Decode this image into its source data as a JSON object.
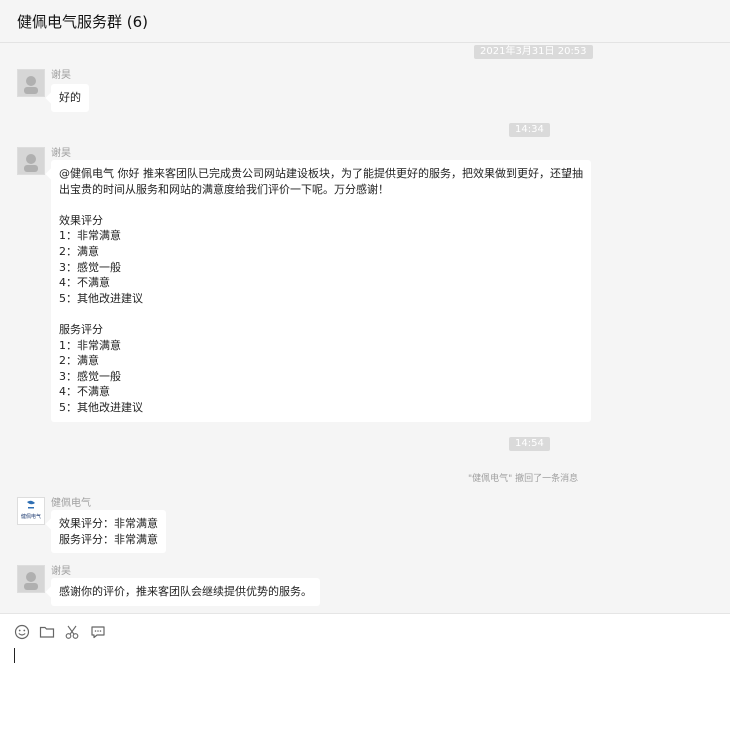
{
  "header": {
    "title": "健佩电气服务群 (6)"
  },
  "messages": {
    "ts1": "2021年3月31日 20:53",
    "m1": {
      "sender": "谢昊",
      "text": "好的"
    },
    "ts2": "14:34",
    "m2": {
      "sender": "谢昊",
      "text": "@健佩电气 你好 推来客团队已完成贵公司网站建设板块，为了能提供更好的服务，把效果做到更好，还望抽出宝贵的时间从服务和网站的满意度给我们评价一下呢。万分感谢！\n\n效果评分\n1：非常满意\n2：满意\n3：感觉一般\n4：不满意\n5：其他改进建议\n\n服务评分\n1：非常满意\n2：满意\n3：感觉一般\n4：不满意\n5：其他改进建议"
    },
    "ts3": "14:54",
    "recall": "\"健佩电气\" 撤回了一条消息",
    "m3": {
      "sender": "健佩电气",
      "logo_text": "健佩电气",
      "text": "效果评分：非常满意\n服务评分：非常满意"
    },
    "m4": {
      "sender": "谢昊",
      "text": "感谢你的评价，推来客团队会继续提供优势的服务。"
    }
  },
  "toolbar": {
    "icons": [
      "emoji-icon",
      "folder-icon",
      "scissors-icon",
      "chat-bubble-icon"
    ]
  },
  "colors": {
    "background": "#f5f5f5",
    "bubble": "#ffffff",
    "timestamp_bg": "#dadada",
    "meta_text": "#a0a0a0"
  }
}
